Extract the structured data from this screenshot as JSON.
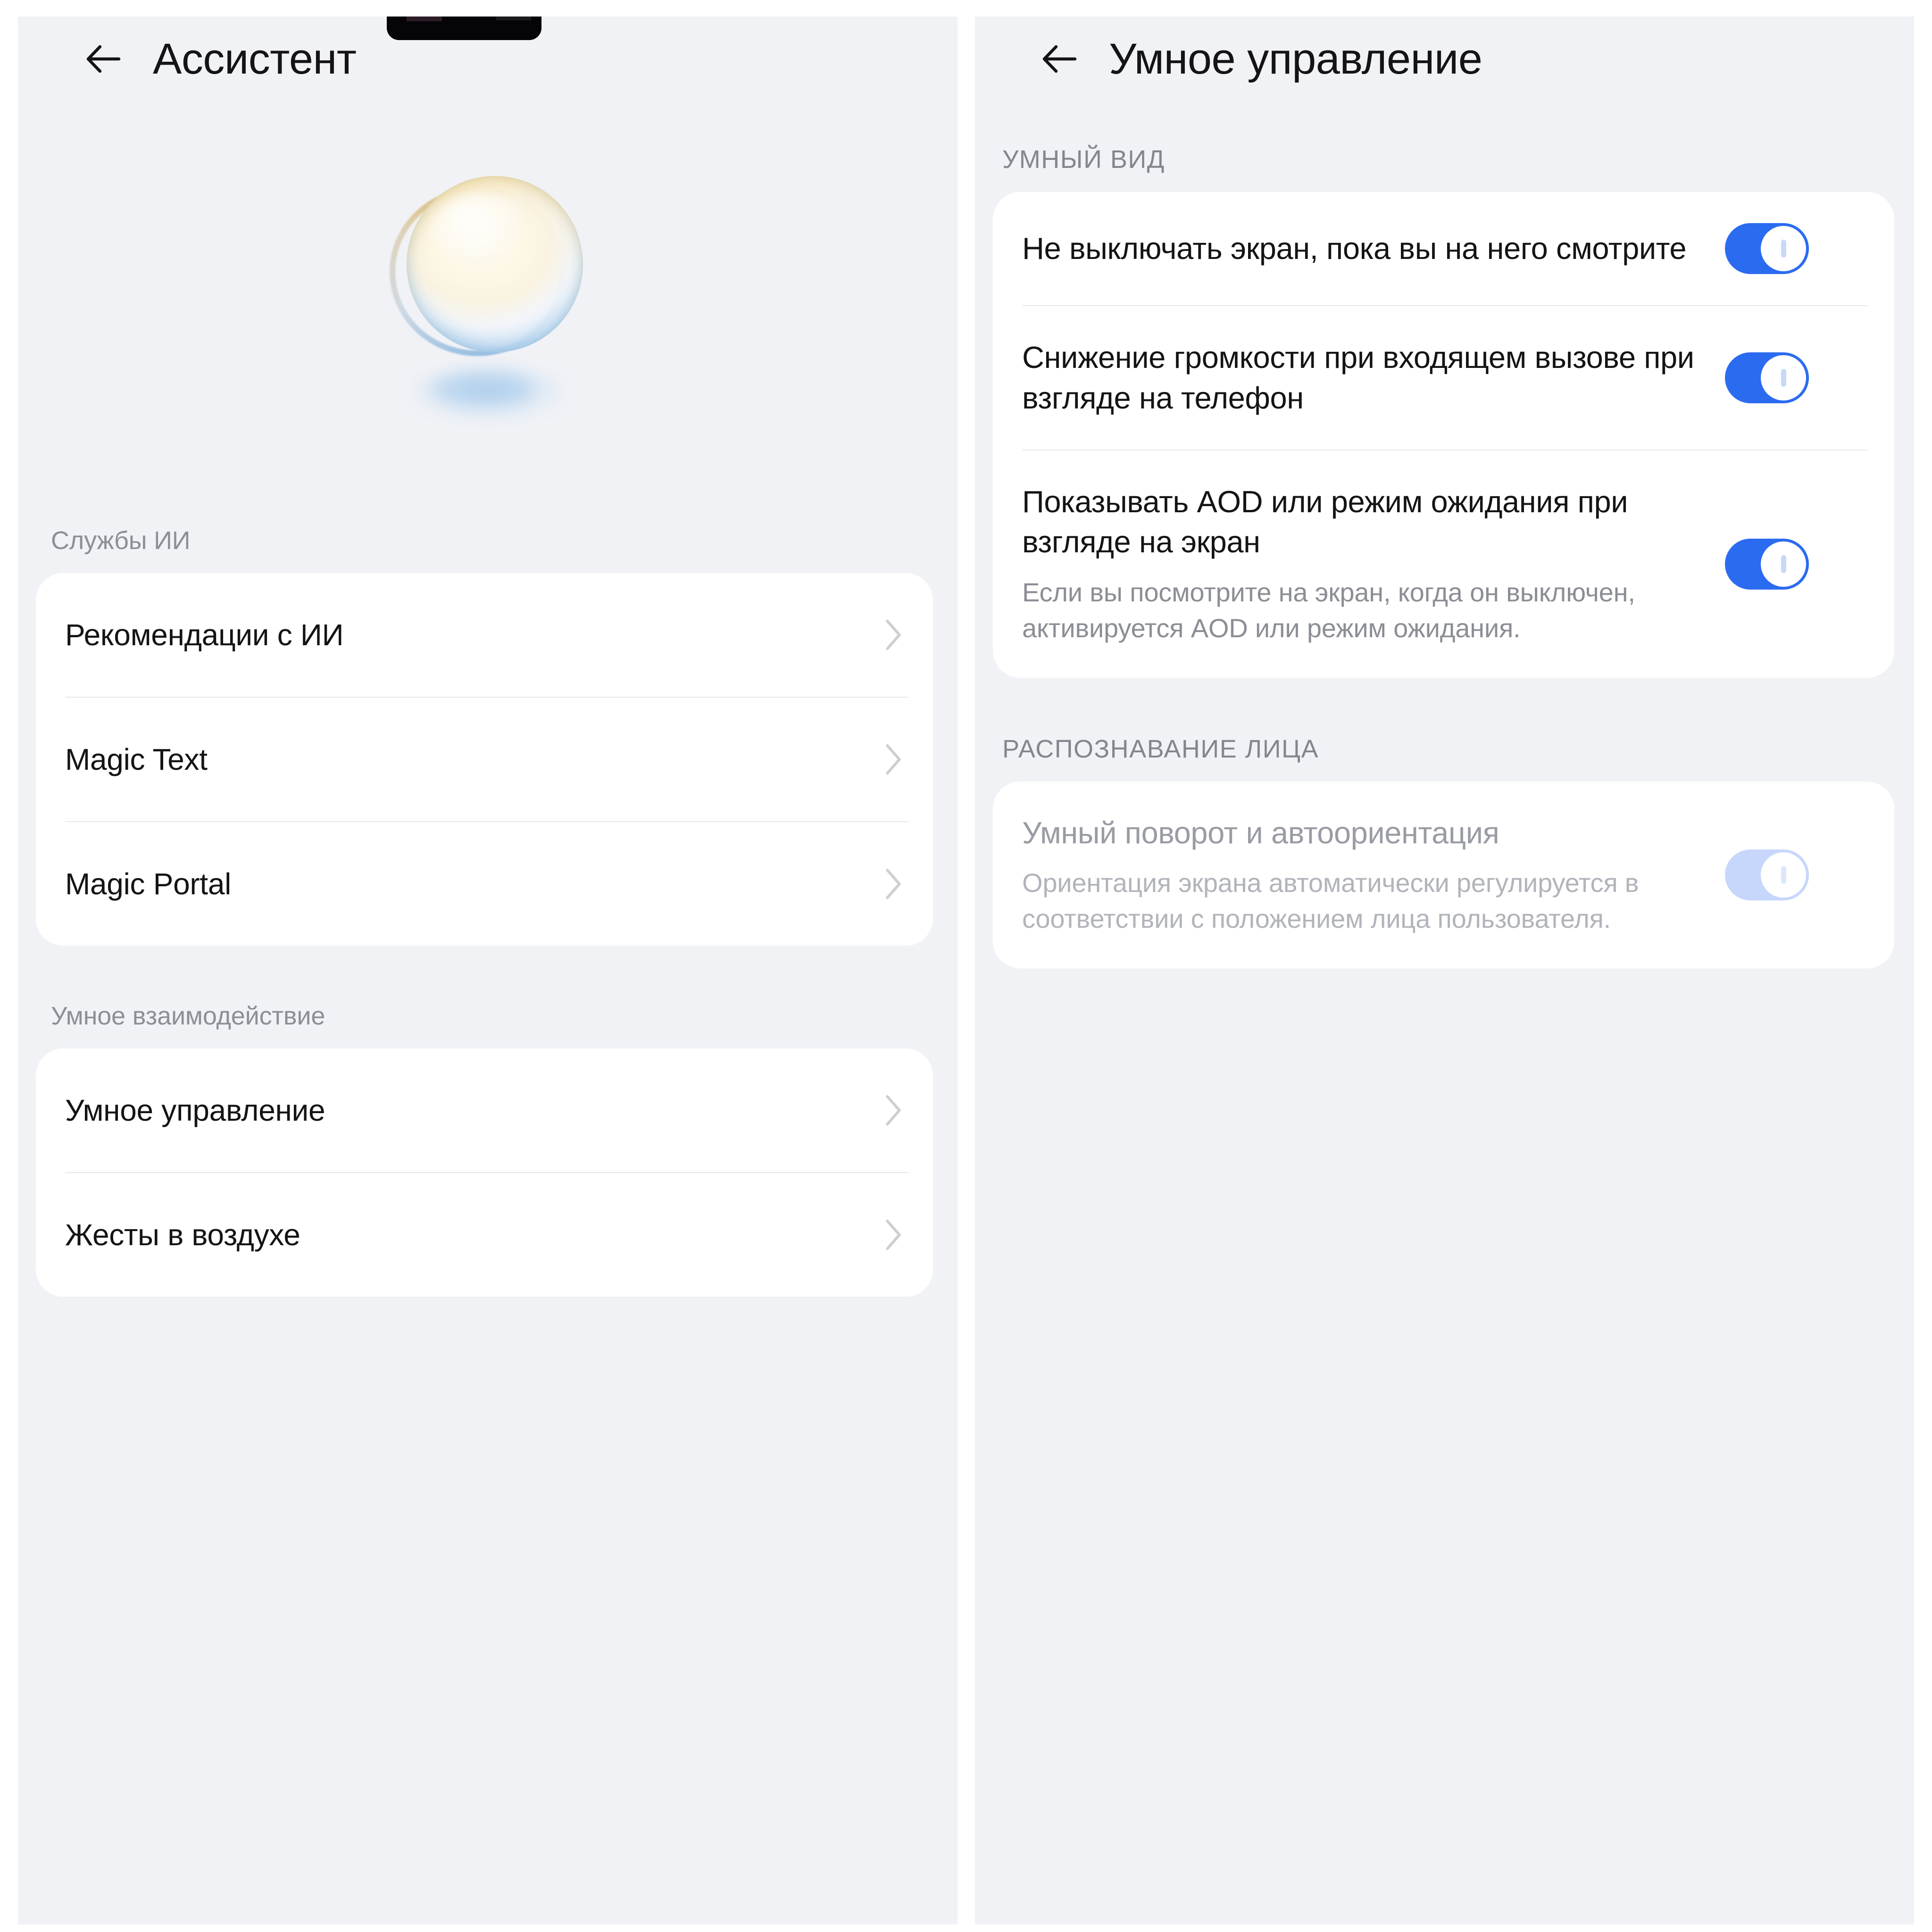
{
  "left_screen": {
    "header": {
      "back_icon": "arrow-left-icon",
      "title": "Ассистент"
    },
    "hero": {
      "image_name": "assistant-orb-illustration"
    },
    "sections": [
      {
        "label": "Службы ИИ",
        "items": [
          {
            "label": "Рекомендации с ИИ",
            "chevron": "chevron-right-icon"
          },
          {
            "label": "Magic Text",
            "chevron": "chevron-right-icon"
          },
          {
            "label": "Magic Portal",
            "chevron": "chevron-right-icon"
          }
        ]
      },
      {
        "label": "Умное взаимодействие",
        "items": [
          {
            "label": "Умное управление",
            "chevron": "chevron-right-icon"
          },
          {
            "label": "Жесты в воздухе",
            "chevron": "chevron-right-icon"
          }
        ]
      }
    ]
  },
  "right_screen": {
    "header": {
      "back_icon": "arrow-left-icon",
      "title": "Умное управление"
    },
    "sections": [
      {
        "label": "УМНЫЙ ВИД",
        "items": [
          {
            "title": "Не выключать экран, пока вы на него смотрите",
            "desc": "",
            "toggle_on": true,
            "disabled": false
          },
          {
            "title": "Снижение громкости при входящем вызове при взгляде на телефон",
            "desc": "",
            "toggle_on": true,
            "disabled": false
          },
          {
            "title": "Показывать AOD или режим ожидания при взгляде на экран",
            "desc": "Если вы посмотрите на экран, когда он выключен, активируется AOD или режим ожидания.",
            "toggle_on": true,
            "disabled": false
          }
        ]
      },
      {
        "label": "РАСПОЗНАВАНИЕ ЛИЦА",
        "items": [
          {
            "title": "Умный поворот и автоориентация",
            "desc": "Ориентация экрана автоматически регулируется в соответствии с положением лица пользователя.",
            "toggle_on": true,
            "disabled": true
          }
        ]
      }
    ]
  },
  "colors": {
    "page_background": "#ffffff",
    "panel_background": "#f1f2f6",
    "card_background": "#ffffff",
    "primary_text": "#141414",
    "secondary_text": "#8c8e96",
    "disabled_text": "#9a9ca4",
    "toggle_on": "#2b6bf0",
    "toggle_disabled": "#c6d7fb",
    "divider": "#e7e8ea",
    "chevron": "#cfcfd2",
    "notch": "#050406"
  }
}
